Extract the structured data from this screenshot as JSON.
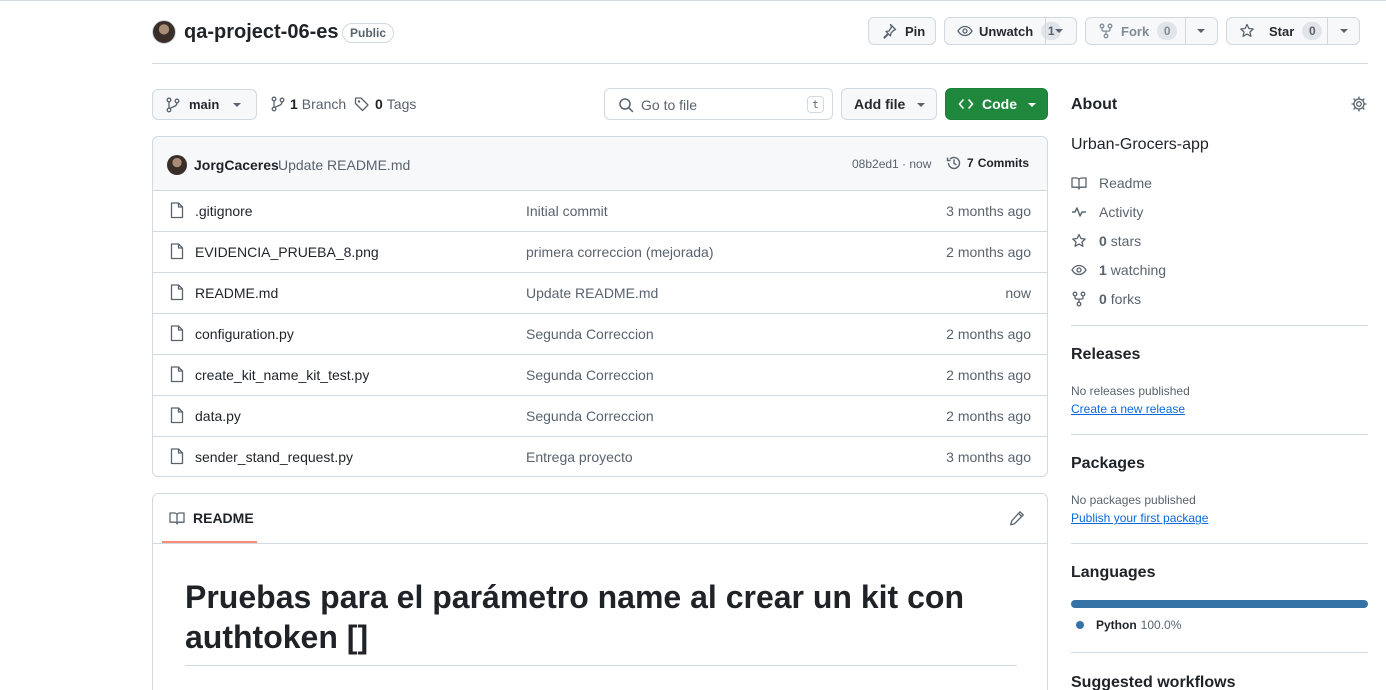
{
  "repo": {
    "name": "qa-project-06-es",
    "visibility": "Public",
    "actions": {
      "pin": "Pin",
      "unwatch": "Unwatch",
      "watch_count": "1",
      "fork": "Fork",
      "fork_count": "0",
      "star": "Star",
      "star_count": "0"
    }
  },
  "toolbar": {
    "branch": "main",
    "branch_count": "1",
    "branch_label": "Branch",
    "tag_count": "0",
    "tag_label": "Tags",
    "search_placeholder": "Go to file",
    "search_shortcut": "t",
    "add_file": "Add file",
    "code": "Code"
  },
  "latest_commit": {
    "author": "JorgCaceres",
    "message": "Update README.md",
    "sha_time": "08b2ed1 · now",
    "commits_count": "7",
    "commits_label": "Commits"
  },
  "files": [
    {
      "name": ".gitignore",
      "message": "Initial commit",
      "date": "3 months ago"
    },
    {
      "name": "EVIDENCIA_PRUEBA_8.png",
      "message": "primera correccion (mejorada)",
      "date": "2 months ago"
    },
    {
      "name": "README.md",
      "message": "Update README.md",
      "date": "now"
    },
    {
      "name": "configuration.py",
      "message": "Segunda Correccion",
      "date": "2 months ago"
    },
    {
      "name": "create_kit_name_kit_test.py",
      "message": "Segunda Correccion",
      "date": "2 months ago"
    },
    {
      "name": "data.py",
      "message": "Segunda Correccion",
      "date": "2 months ago"
    },
    {
      "name": "sender_stand_request.py",
      "message": "Entrega proyecto",
      "date": "3 months ago"
    }
  ],
  "readme": {
    "tab_label": "README",
    "heading_line1": "Pruebas para el parámetro name al crear un kit con",
    "heading_line2": "authtoken []"
  },
  "about": {
    "title": "About",
    "description": "Urban-Grocers-app",
    "readme": "Readme",
    "activity": "Activity",
    "stars_count": "0",
    "stars_label": "stars",
    "watching_count": "1",
    "watching_label": "watching",
    "forks_count": "0",
    "forks_label": "forks"
  },
  "releases": {
    "title": "Releases",
    "empty": "No releases published",
    "link": "Create a new release"
  },
  "packages": {
    "title": "Packages",
    "empty": "No packages published",
    "link": "Publish your first package"
  },
  "languages": {
    "title": "Languages",
    "items": [
      {
        "name": "Python",
        "percent": "100.0%",
        "fraction": 1.0,
        "color": "#3572A5"
      }
    ]
  },
  "suggested": {
    "title": "Suggested workflows"
  },
  "colors": {
    "code_button": "#1f883d",
    "readme_underline": "#fd8c73",
    "link": "#0969da",
    "python": "#3572A5"
  }
}
